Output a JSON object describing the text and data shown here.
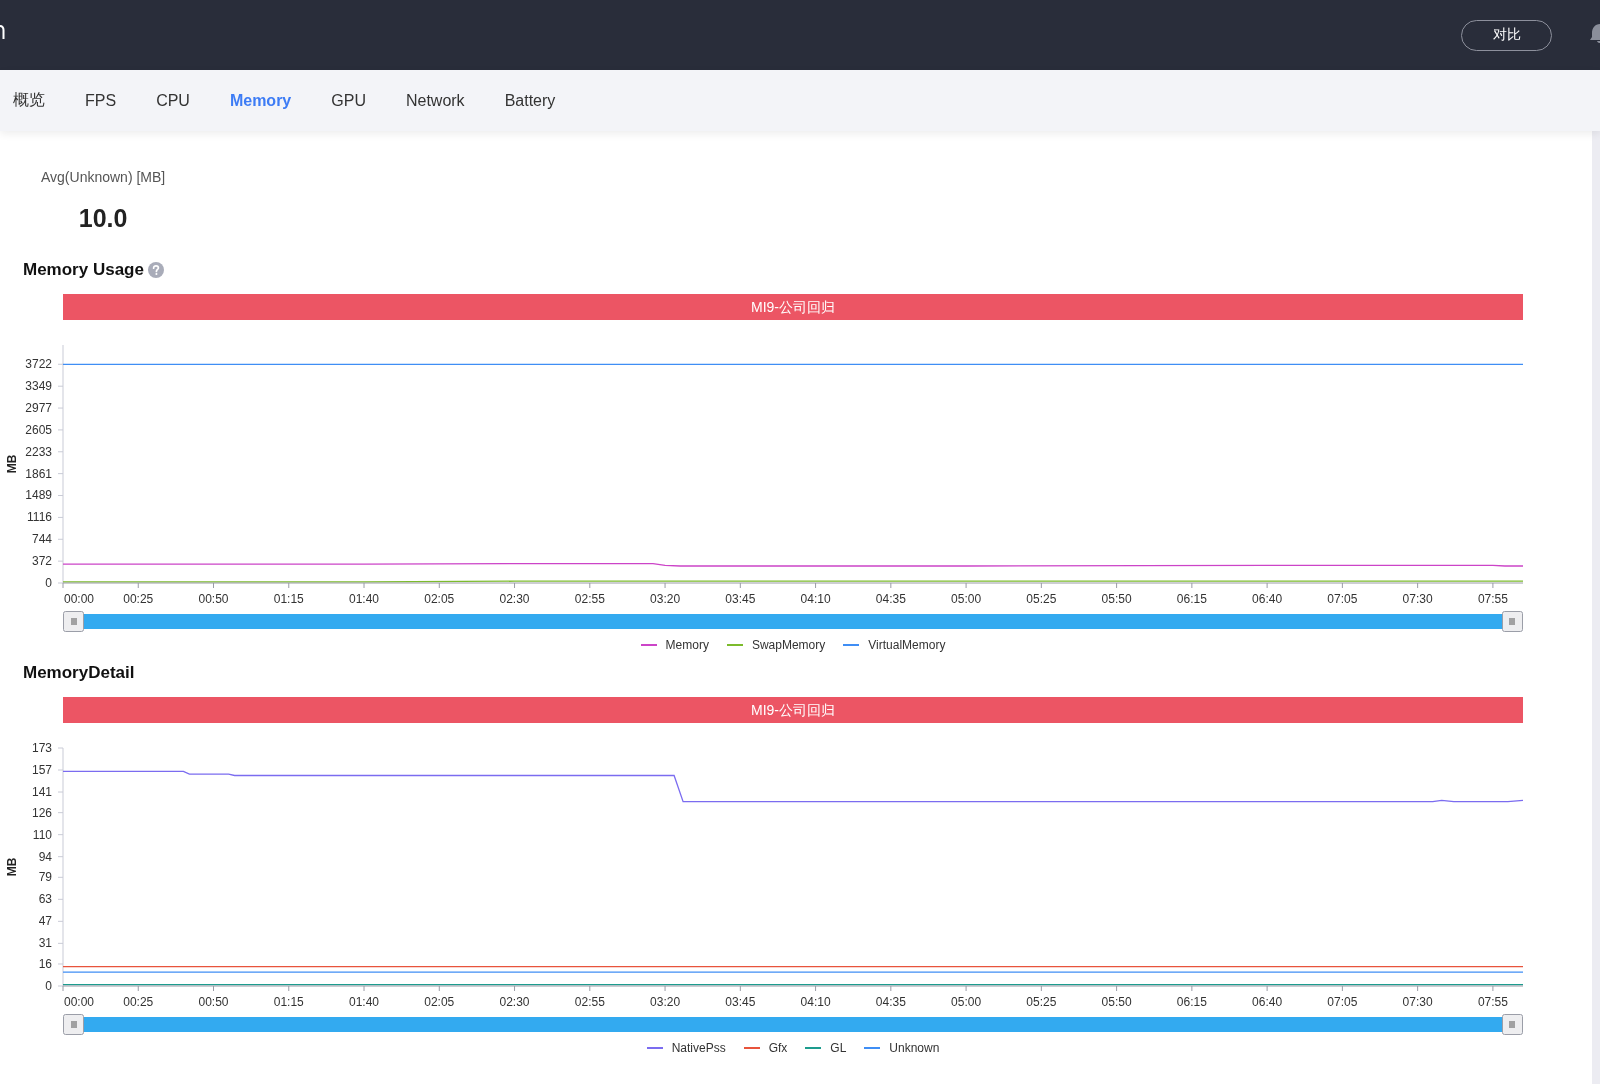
{
  "header": {
    "compare_button": "对比"
  },
  "tabs": [
    {
      "label": "概览",
      "selected": false
    },
    {
      "label": "FPS",
      "selected": false
    },
    {
      "label": "CPU",
      "selected": false
    },
    {
      "label": "Memory",
      "selected": true
    },
    {
      "label": "GPU",
      "selected": false
    },
    {
      "label": "Network",
      "selected": false
    },
    {
      "label": "Battery",
      "selected": false
    }
  ],
  "summary": {
    "label": "Avg(Unknown) [MB]",
    "value": "10.0"
  },
  "sections": [
    {
      "title": "Memory Usage",
      "help": true,
      "banner": "MI9-公司回归",
      "chart_data": {
        "type": "line",
        "ylabel": "MB",
        "legend": "bottom",
        "x": [
          0,
          100,
          150,
          196,
          200,
          205,
          300,
          400,
          475,
          479,
          485
        ],
        "series": [
          {
            "name": "Memory",
            "color": "#cc44c8",
            "values": [
              320,
              320,
              330,
              330,
              300,
              290,
              290,
              300,
              300,
              290,
              290
            ]
          },
          {
            "name": "SwapMemory",
            "color": "#7cbb2c",
            "values": [
              20,
              20,
              30,
              30,
              30,
              30,
              30,
              30,
              30,
              30,
              30
            ]
          },
          {
            "name": "VirtualMemory",
            "color": "#3f8ef5",
            "values": [
              3720,
              3720,
              3720,
              3720,
              3720,
              3720,
              3720,
              3720,
              3720,
              3720,
              3720
            ]
          }
        ],
        "xlim": [
          0,
          485
        ],
        "ylim": [
          0,
          4050
        ],
        "xticks": [
          {
            "value": 0,
            "label": "00:00"
          },
          {
            "value": 25,
            "label": "00:25"
          },
          {
            "value": 50,
            "label": "00:50"
          },
          {
            "value": 75,
            "label": "01:15"
          },
          {
            "value": 100,
            "label": "01:40"
          },
          {
            "value": 125,
            "label": "02:05"
          },
          {
            "value": 150,
            "label": "02:30"
          },
          {
            "value": 175,
            "label": "02:55"
          },
          {
            "value": 200,
            "label": "03:20"
          },
          {
            "value": 225,
            "label": "03:45"
          },
          {
            "value": 250,
            "label": "04:10"
          },
          {
            "value": 275,
            "label": "04:35"
          },
          {
            "value": 300,
            "label": "05:00"
          },
          {
            "value": 325,
            "label": "05:25"
          },
          {
            "value": 350,
            "label": "05:50"
          },
          {
            "value": 375,
            "label": "06:15"
          },
          {
            "value": 400,
            "label": "06:40"
          },
          {
            "value": 425,
            "label": "07:05"
          },
          {
            "value": 450,
            "label": "07:30"
          },
          {
            "value": 475,
            "label": "07:55"
          }
        ],
        "yticks": [
          0,
          372,
          744,
          1116,
          1489,
          1861,
          2233,
          2605,
          2977,
          3349,
          3722
        ]
      }
    },
    {
      "title": "MemoryDetail",
      "help": false,
      "banner": "MI9-公司回归",
      "chart_data": {
        "type": "line",
        "ylabel": "MB",
        "legend": "bottom",
        "x": [
          0,
          40,
          42,
          55,
          57,
          203,
          206,
          455,
          458,
          462,
          480,
          485
        ],
        "series": [
          {
            "name": "NativePss",
            "color": "#7b6cf0",
            "values": [
              156,
              156,
              154,
              154,
              153,
              153,
              134,
              134,
              135,
              134,
              134,
              135
            ]
          },
          {
            "name": "Gfx",
            "color": "#e8543c",
            "values": [
              14,
              14,
              14,
              14,
              14,
              14,
              14,
              14,
              14,
              14,
              14,
              14
            ]
          },
          {
            "name": "GL",
            "color": "#1d9c8e",
            "values": [
              1,
              1,
              1,
              1,
              1,
              1,
              1,
              1,
              1,
              1,
              1,
              1
            ]
          },
          {
            "name": "Unknown",
            "color": "#3f8ef5",
            "values": [
              10,
              10,
              10,
              10,
              10,
              10,
              10,
              10,
              10,
              10,
              10,
              10
            ]
          }
        ],
        "xlim": [
          0,
          485
        ],
        "ylim": [
          0,
          173
        ],
        "xticks": [
          {
            "value": 0,
            "label": "00:00"
          },
          {
            "value": 25,
            "label": "00:25"
          },
          {
            "value": 50,
            "label": "00:50"
          },
          {
            "value": 75,
            "label": "01:15"
          },
          {
            "value": 100,
            "label": "01:40"
          },
          {
            "value": 125,
            "label": "02:05"
          },
          {
            "value": 150,
            "label": "02:30"
          },
          {
            "value": 175,
            "label": "02:55"
          },
          {
            "value": 200,
            "label": "03:20"
          },
          {
            "value": 225,
            "label": "03:45"
          },
          {
            "value": 250,
            "label": "04:10"
          },
          {
            "value": 275,
            "label": "04:35"
          },
          {
            "value": 300,
            "label": "05:00"
          },
          {
            "value": 325,
            "label": "05:25"
          },
          {
            "value": 350,
            "label": "05:50"
          },
          {
            "value": 375,
            "label": "06:15"
          },
          {
            "value": 400,
            "label": "06:40"
          },
          {
            "value": 425,
            "label": "07:05"
          },
          {
            "value": 450,
            "label": "07:30"
          },
          {
            "value": 475,
            "label": "07:55"
          }
        ],
        "yticks": [
          0,
          16,
          31,
          47,
          63,
          79,
          94,
          110,
          126,
          141,
          157,
          173
        ]
      }
    }
  ]
}
